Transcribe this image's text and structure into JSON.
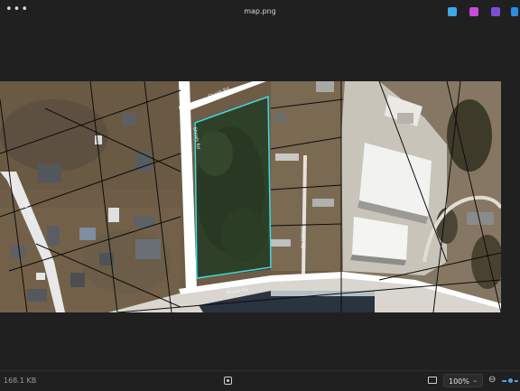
{
  "window": {
    "title": "map.png",
    "more_label": "•••"
  },
  "toolbar_icons": [
    {
      "name": "edit-icon",
      "color": "#3fa7e8"
    },
    {
      "name": "designer-icon",
      "color": "#c64bd8"
    },
    {
      "name": "clipchamp-icon",
      "color": "#7a4fd6"
    },
    {
      "name": "onedrive-icon",
      "color": "#2a8fe0"
    }
  ],
  "map": {
    "road_labels": [
      "Shoals Rd",
      "Shoals Rd",
      "Shoals Rd",
      "Shoals Rd",
      "Shoals Rd"
    ],
    "parcel_outline_color": "#41d8e6",
    "road_color": "#ffffff"
  },
  "status": {
    "file_size": "168.1 KB",
    "zoom_value": "100%",
    "zoom_chevron": "⌄",
    "zoom_level": 0.5
  }
}
